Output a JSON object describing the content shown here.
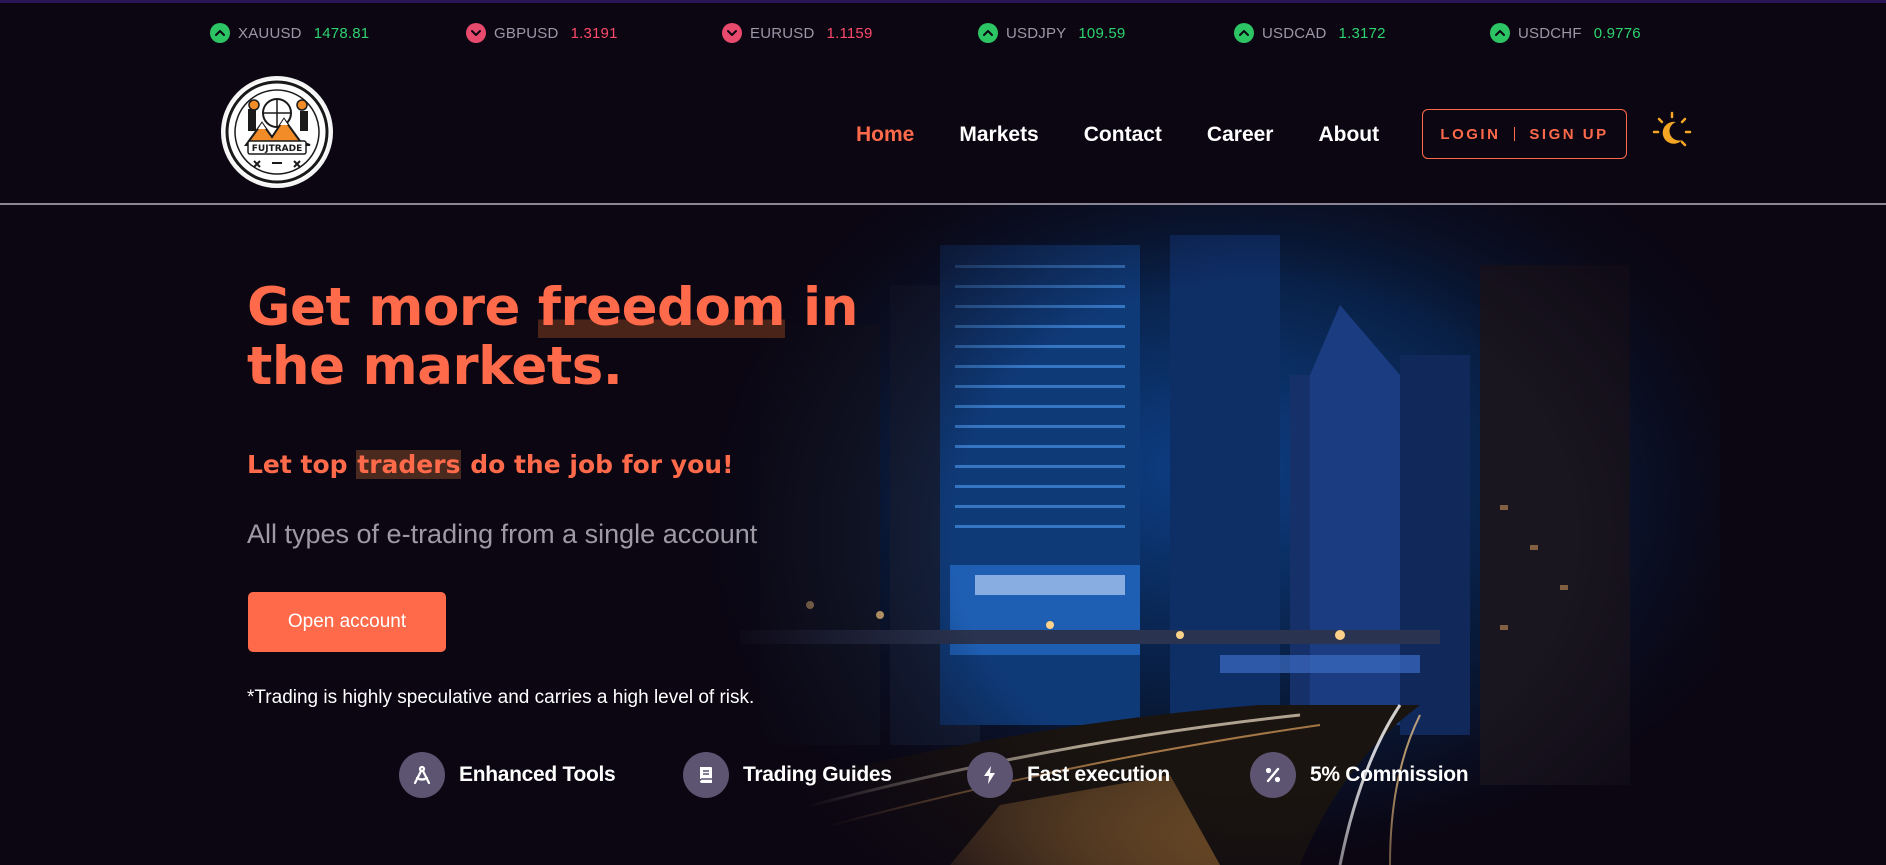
{
  "ticker": [
    {
      "symbol": "XAUUSD",
      "value": "1478.81",
      "direction": "up"
    },
    {
      "symbol": "GBPUSD",
      "value": "1.3191",
      "direction": "down"
    },
    {
      "symbol": "EURUSD",
      "value": "1.1159",
      "direction": "down"
    },
    {
      "symbol": "USDJPY",
      "value": "109.59",
      "direction": "up"
    },
    {
      "symbol": "USDCAD",
      "value": "1.3172",
      "direction": "up"
    },
    {
      "symbol": "USDCHF",
      "value": "0.9776",
      "direction": "up"
    }
  ],
  "brand": {
    "logo_text": "FUJTRADE"
  },
  "nav": {
    "items": [
      {
        "label": "Home",
        "active": true
      },
      {
        "label": "Markets",
        "active": false
      },
      {
        "label": "Contact",
        "active": false
      },
      {
        "label": "Career",
        "active": false
      },
      {
        "label": "About",
        "active": false
      }
    ]
  },
  "auth": {
    "login": "LOGIN",
    "signup": "SIGN UP"
  },
  "theme_toggle": {
    "icon": "moon-sun-icon"
  },
  "hero": {
    "headline_part1": "Get more ",
    "headline_highlight": "freedom",
    "headline_part2": " in the markets.",
    "subhead_part1": "Let top ",
    "subhead_highlight": "traders",
    "subhead_part2": " do the job for you!",
    "tagline": "All types of e-trading from a single account",
    "cta": "Open account",
    "disclaimer": "*Trading is highly speculative and carries a high level of risk."
  },
  "features": [
    {
      "label": "Enhanced Tools",
      "icon": "drafting-compass-icon"
    },
    {
      "label": "Trading Guides",
      "icon": "book-icon"
    },
    {
      "label": "Fast execution",
      "icon": "lightning-bolt-icon"
    },
    {
      "label": "5% Commission",
      "icon": "percent-icon"
    }
  ],
  "colors": {
    "background": "#0b0612",
    "accent": "#ff6a4a",
    "up": "#2dd36f",
    "down": "#ff4a6b",
    "feature_icon_bg": "#5c5471"
  }
}
